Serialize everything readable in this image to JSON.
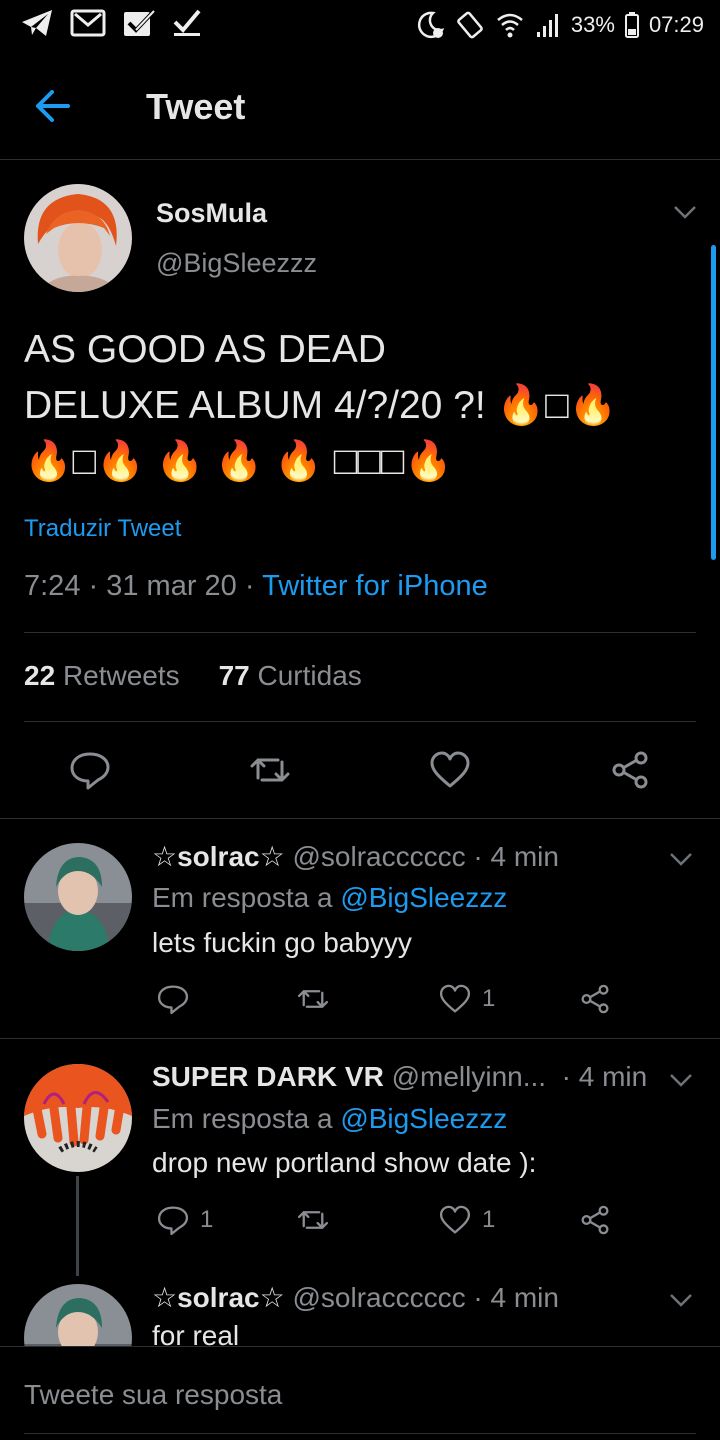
{
  "status_bar": {
    "battery": "33%",
    "time": "07:29",
    "icons": [
      "telegram-icon",
      "gmail-icon",
      "check-box-icon",
      "checkmark-icon",
      "dnd-icon",
      "rotate-icon",
      "wifi-icon",
      "signal-icon",
      "battery-icon"
    ]
  },
  "header": {
    "title": "Tweet"
  },
  "main_tweet": {
    "name": "SosMula",
    "handle": "@BigSleezzz",
    "text_line1": "AS GOOD AS DEAD",
    "text_line2": "DELUXE ALBUM 4/?/20 ?! 🔥□🔥",
    "text_line3": "🔥□🔥 🔥 🔥 🔥 □□□🔥",
    "translate": "Traduzir Tweet",
    "time": "7:24",
    "date": "31 mar 20",
    "source": "Twitter for iPhone",
    "retweets_count": "22",
    "retweets_label": "Retweets",
    "likes_count": "77",
    "likes_label": "Curtidas"
  },
  "replies": [
    {
      "name": "☆solrac☆",
      "handle": "@solracccccc",
      "time": "4 min",
      "reply_prefix": "Em resposta a",
      "reply_to": "@BigSleezzz",
      "text": "lets fuckin go babyyy",
      "reply_count": "",
      "like_count": "1"
    },
    {
      "name": "SUPER DARK VR",
      "handle": "@mellyinn...",
      "time": "4 min",
      "reply_prefix": "Em resposta a",
      "reply_to": "@BigSleezzz",
      "text": "drop new portland show date ):",
      "reply_count": "1",
      "like_count": "1"
    },
    {
      "name": "☆solrac☆",
      "handle": "@solracccccc",
      "time": "4 min",
      "text": "for real"
    }
  ],
  "composer": {
    "placeholder": "Tweete sua resposta"
  },
  "colors": {
    "accent": "#1d9bf0",
    "background": "#000000",
    "muted": "#8a8d91"
  }
}
